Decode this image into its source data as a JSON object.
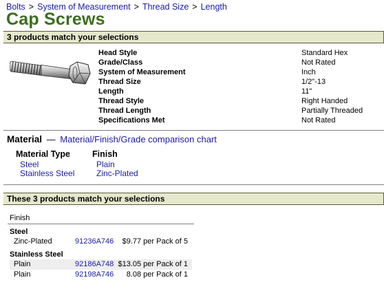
{
  "breadcrumb": {
    "items": [
      "Bolts",
      "System of Measurement",
      "Thread Size",
      "Length"
    ],
    "separator": ">"
  },
  "title": "Cap Screws",
  "summary_bar": "3 products match your selections",
  "product_icon": "hex-cap-screw-icon",
  "specs": [
    {
      "label": "Head Style",
      "value": "Standard Hex"
    },
    {
      "label": "Grade/Class",
      "value": "Not Rated"
    },
    {
      "label": "System of Measurement",
      "value": "Inch"
    },
    {
      "label": "Thread Size",
      "value": "1/2\"-13"
    },
    {
      "label": "Length",
      "value": "11\""
    },
    {
      "label": "Thread Style",
      "value": "Right Handed"
    },
    {
      "label": "Thread Length",
      "value": "Partially Threaded"
    },
    {
      "label": "Specifications Met",
      "value": "Not Rated"
    }
  ],
  "material": {
    "heading": "Material",
    "dash": "—",
    "chart_link": "Material/Finish/Grade comparison chart",
    "type_header": "Material Type",
    "types": [
      "Steel",
      "Stainless Steel"
    ],
    "finish_header": "Finish",
    "finishes": [
      "Plain",
      "Zinc-Plated"
    ]
  },
  "results_bar": "These 3 products match your selections",
  "results": {
    "header": "Finish",
    "groups": [
      {
        "name": "Steel",
        "rows": [
          {
            "finish": "Zinc-Plated",
            "part": "91236A746",
            "price": "$9.77 per Pack of 5"
          }
        ]
      },
      {
        "name": "Stainless Steel",
        "rows": [
          {
            "finish": "Plain",
            "part": "92186A748",
            "price": "$13.05 per Pack of 1"
          },
          {
            "finish": "Plain",
            "part": "92198A746",
            "price": "8.08 per Pack of 1"
          }
        ]
      }
    ]
  },
  "colors": {
    "title_green": "#3c6e1f",
    "bar_bg": "#e6e8cc",
    "link_blue": "#1a1aa6"
  }
}
